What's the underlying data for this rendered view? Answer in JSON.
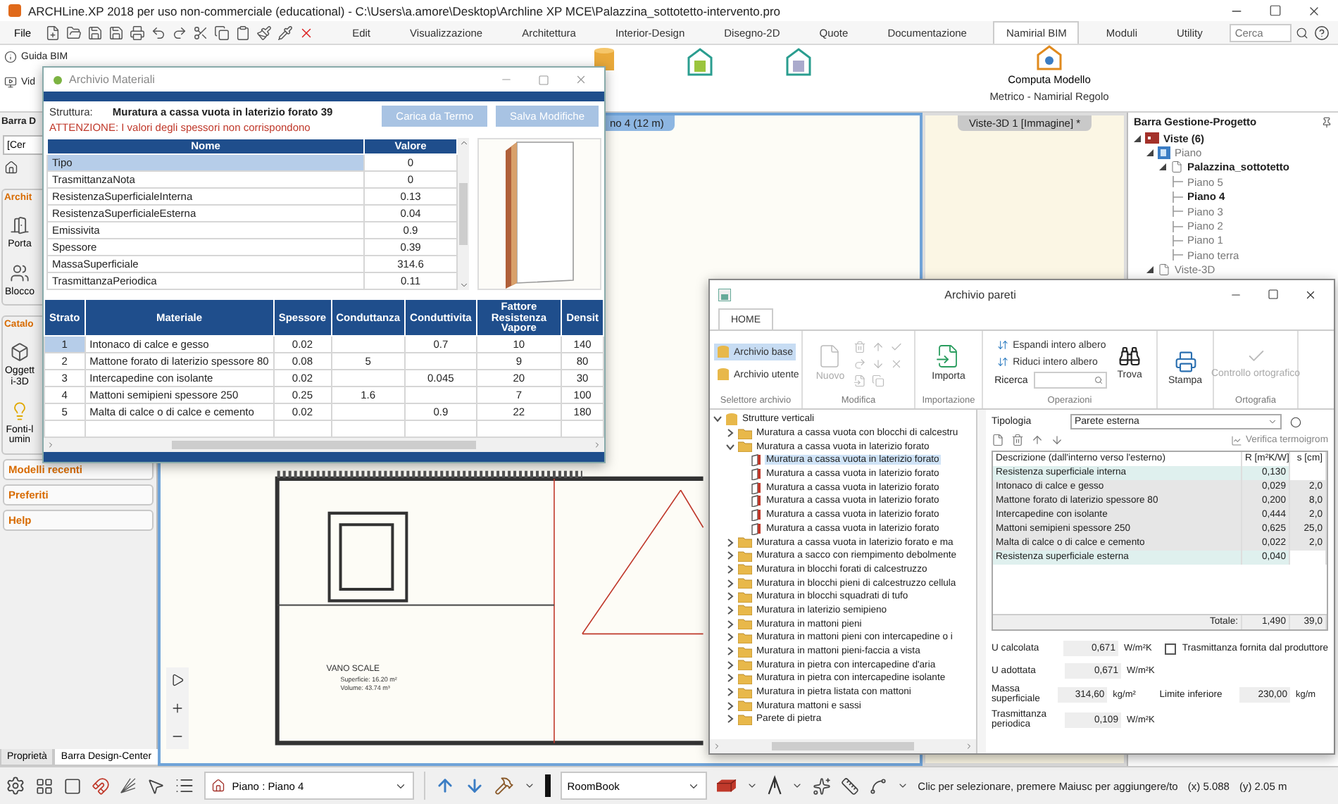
{
  "window": {
    "title": "ARCHLine.XP 2018 per uso non-commerciale (educational) - C:\\Users\\a.amore\\Desktop\\Archline XP MCE\\Palazzina_sottotetto-intervento.pro"
  },
  "menu": {
    "file": "File",
    "tabs": [
      {
        "label": "Edit",
        "selected": false
      },
      {
        "label": "Visualizzazione",
        "selected": false
      },
      {
        "label": "Architettura",
        "selected": false
      },
      {
        "label": "Interior-Design",
        "selected": false
      },
      {
        "label": "Disegno-2D",
        "selected": false
      },
      {
        "label": "Quote",
        "selected": false
      },
      {
        "label": "Documentazione",
        "selected": false
      },
      {
        "label": "Namirial BIM",
        "selected": true
      },
      {
        "label": "Moduli",
        "selected": false
      },
      {
        "label": "Utility",
        "selected": false
      }
    ]
  },
  "search": {
    "placeholder": "Cerca"
  },
  "ribbon": {
    "links": [
      "Guida BIM",
      "Vid"
    ],
    "command": "Computa Modello",
    "group_label": "Metrico - Namirial Regolo"
  },
  "left_panel": {
    "title": "Barra D",
    "search": {
      "value": "[Cer"
    },
    "sections": [
      {
        "title": "Archit",
        "items": [
          "Porta",
          "Blocco"
        ]
      },
      {
        "title": "Catalo",
        "items": [
          "Oggetti-3D",
          "Fonti-lumin"
        ]
      }
    ],
    "headers": [
      "Modelli recenti",
      "Preferiti",
      "Help"
    ],
    "tabs": [
      {
        "label": "Proprietà",
        "selected": false
      },
      {
        "label": "Barra Design-Center",
        "selected": true
      }
    ]
  },
  "views": [
    {
      "label": "no 4 (12 m)",
      "selected": true
    },
    {
      "label": "Viste-3D 1 [Immagine] *",
      "selected": false
    }
  ],
  "plan": {
    "room_name": "VANO SCALE",
    "area": "Superficie: 16.20 m²",
    "volume": "Volume: 43.74 m³"
  },
  "project_panel": {
    "title": "Barra Gestione-Progetto",
    "tree": [
      {
        "label": "Viste (6)",
        "active": true,
        "expanded": true,
        "children": [
          {
            "label": "Piano",
            "active": false,
            "expanded": true,
            "children": [
              {
                "label": "Palazzina_sottotetto",
                "active": true,
                "expanded": true,
                "children": [
                  {
                    "label": "Piano 5",
                    "active": false
                  },
                  {
                    "label": "Piano 4",
                    "active": true
                  },
                  {
                    "label": "Piano 3",
                    "active": false
                  },
                  {
                    "label": "Piano 2",
                    "active": false
                  },
                  {
                    "label": "Piano 1",
                    "active": false
                  },
                  {
                    "label": "Piano terra",
                    "active": false
                  }
                ]
              }
            ]
          },
          {
            "label": "Viste-3D",
            "active": false,
            "expanded": true
          }
        ]
      }
    ]
  },
  "materials_dialog": {
    "title": "Archivio Materiali",
    "structure_label": "Struttura:",
    "structure": "Muratura a cassa vuota in laterizio forato 39",
    "warning": "ATTENZIONE: I valori degli spessori non corrispondono",
    "buttons": [
      {
        "label": "Carica da Termo",
        "disabled": true
      },
      {
        "label": "Salva Modifiche",
        "disabled": true
      }
    ],
    "properties": {
      "columns": [
        "Nome",
        "Valore"
      ],
      "rows": [
        {
          "name": "Tipo",
          "value": "0",
          "selected": true
        },
        {
          "name": "TrasmittanzaNota",
          "value": "0",
          "selected": false
        },
        {
          "name": "ResistenzaSuperficialeInterna",
          "value": "0.13",
          "selected": false
        },
        {
          "name": "ResistenzaSuperficialeEsterna",
          "value": "0.04",
          "selected": false
        },
        {
          "name": "Emissivita",
          "value": "0.9",
          "selected": false
        },
        {
          "name": "Spessore",
          "value": "0.39",
          "selected": false
        },
        {
          "name": "MassaSuperficiale",
          "value": "314.6",
          "selected": false
        },
        {
          "name": "TrasmittanzaPeriodica",
          "value": "0.11",
          "selected": false
        }
      ]
    },
    "layers": {
      "columns": [
        "Strato",
        "Materiale",
        "Spessore",
        "Conduttanza",
        "Conduttivita",
        "Fattore Resistenza Vapore",
        "Densit"
      ],
      "rows": [
        {
          "strato": "1",
          "materiale": "Intonaco di calce e gesso",
          "spessore": "0.02",
          "conduttivita": "0.7",
          "fattore": "10",
          "column_7": "140",
          "selected": true
        },
        {
          "strato": "2",
          "materiale": "Mattone forato di laterizio spessore 80",
          "spessore": "0.08",
          "conduttanza": "5",
          "fattore": "9",
          "column_7": "80",
          "selected": false
        },
        {
          "strato": "3",
          "materiale": "Intercapedine con isolante",
          "spessore": "0.02",
          "conduttivita": "0.045",
          "fattore": "20",
          "column_7": "30",
          "selected": false
        },
        {
          "strato": "4",
          "materiale": "Mattoni semipieni spessore 250",
          "spessore": "0.25",
          "conduttanza": "1.6",
          "fattore": "7",
          "column_7": "100",
          "selected": false
        },
        {
          "strato": "5",
          "materiale": "Malta di calce o di calce e cemento",
          "spessore": "0.02",
          "conduttivita": "0.9",
          "fattore": "22",
          "column_7": "180",
          "selected": false
        }
      ]
    }
  },
  "pareti_dialog": {
    "title": "Archivio pareti",
    "tabs": [
      {
        "label": "HOME",
        "selected": true
      }
    ],
    "ribbon": {
      "archives": [
        {
          "label": "Archivio base",
          "selected": true
        },
        {
          "label": "Archivio utente",
          "selected": false
        }
      ],
      "new": {
        "label": "Nuovo",
        "disabled": true
      },
      "import": "Importa",
      "expand": "Espandi intero albero",
      "collapse": "Riduci intero albero",
      "search_label": "Ricerca",
      "find": "Trova",
      "print": "Stampa",
      "spell": {
        "label": "Controllo ortografico",
        "disabled": true
      },
      "groups": [
        "Selettore archivio",
        "Modifica",
        "Importazione",
        "Operazioni",
        "Ortografia"
      ]
    },
    "tree": [
      {
        "label": "Strutture verticali",
        "kind": "root",
        "expanded": true,
        "children": [
          {
            "label": "Muratura a cassa vuota con blocchi di calcestru",
            "kind": "folder",
            "expanded": false
          },
          {
            "label": "Muratura a cassa vuota in laterizio forato",
            "kind": "folder",
            "expanded": true,
            "children": [
              {
                "label": "Muratura a cassa vuota in laterizio forato",
                "kind": "wall",
                "selected": true
              },
              {
                "label": "Muratura a cassa vuota in laterizio forato",
                "kind": "wall",
                "selected": false
              },
              {
                "label": "Muratura a cassa vuota in laterizio forato",
                "kind": "wall",
                "selected": false
              },
              {
                "label": "Muratura a cassa vuota in laterizio forato",
                "kind": "wall",
                "selected": false
              },
              {
                "label": "Muratura a cassa vuota in laterizio forato",
                "kind": "wall",
                "selected": false
              },
              {
                "label": "Muratura a cassa vuota in laterizio forato",
                "kind": "wall",
                "selected": false
              }
            ]
          },
          {
            "label": "Muratura a cassa vuota in laterizio forato e ma",
            "kind": "folder",
            "expanded": false
          },
          {
            "label": "Muratura a sacco con riempimento debolmente",
            "kind": "folder",
            "expanded": false
          },
          {
            "label": "Muratura in blocchi forati di calcestruzzo",
            "kind": "folder",
            "expanded": false
          },
          {
            "label": "Muratura in blocchi pieni di calcestruzzo cellula",
            "kind": "folder",
            "expanded": false
          },
          {
            "label": "Muratura in blocchi squadrati di tufo",
            "kind": "folder",
            "expanded": false
          },
          {
            "label": "Muratura in laterizio semipieno",
            "kind": "folder",
            "expanded": false
          },
          {
            "label": "Muratura in mattoni pieni",
            "kind": "folder",
            "expanded": false
          },
          {
            "label": "Muratura in mattoni pieni con intercapedine o i",
            "kind": "folder",
            "expanded": false
          },
          {
            "label": "Muratura in mattoni pieni-faccia a vista",
            "kind": "folder",
            "expanded": false
          },
          {
            "label": "Muratura in pietra con intercapedine d'aria",
            "kind": "folder",
            "expanded": false
          },
          {
            "label": "Muratura in pietra con intercapedine isolante",
            "kind": "folder",
            "expanded": false
          },
          {
            "label": "Muratura in pietra listata con mattoni",
            "kind": "folder",
            "expanded": false
          },
          {
            "label": "Muratura mattoni e sassi",
            "kind": "folder",
            "expanded": false
          },
          {
            "label": "Parete di pietra",
            "kind": "folder",
            "expanded": false
          }
        ]
      }
    ],
    "type_label": "Tipologia",
    "type_value": "Parete esterna",
    "verify": "Verifica termoigrom",
    "table": {
      "columns": [
        "Descrizione (dall'interno verso l'esterno)",
        "R [m²K/W]",
        "s [cm]"
      ],
      "rows": [
        {
          "kind": "surface",
          "description": "Resistenza superficiale interna",
          "r": "0,130"
        },
        {
          "kind": "layer",
          "description": "Intonaco di calce e gesso",
          "r": "0,029",
          "s": "2,0"
        },
        {
          "kind": "layer",
          "description": "Mattone forato di laterizio spessore 80",
          "r": "0,200",
          "s": "8,0"
        },
        {
          "kind": "layer",
          "description": "Intercapedine con isolante",
          "r": "0,444",
          "s": "2,0"
        },
        {
          "kind": "layer",
          "description": "Mattoni semipieni spessore 250",
          "r": "0,625",
          "s": "25,0"
        },
        {
          "kind": "layer",
          "description": "Malta di calce o di calce e cemento",
          "r": "0,022",
          "s": "2,0"
        },
        {
          "kind": "surface",
          "description": "Resistenza superficiale esterna",
          "r": "0,040"
        }
      ],
      "total_label": "Totale:",
      "total_r": "1,490",
      "total_s": "39,0"
    },
    "fields": [
      {
        "label": "U calcolata",
        "value": "0,671",
        "unit": "W/m²K",
        "aside": {
          "kind": "checkbox",
          "label": "Trasmittanza fornita dal produttore",
          "checked": false
        }
      },
      {
        "label": "U adottata",
        "value": "0,671",
        "unit": "W/m²K"
      },
      {
        "label": "Massa superficiale",
        "value": "314,60",
        "unit": "kg/m²",
        "aside": {
          "kind": "field",
          "label": "Limite inferiore",
          "value": "230,00",
          "unit": "kg/m"
        }
      },
      {
        "label": "Trasmittanza periodica",
        "value": "0,109",
        "unit": "W/m²K"
      }
    ]
  },
  "status_bar": {
    "floor": "Piano : Piano 4",
    "roombook": "RoomBook",
    "message": "Clic per selezionare, premere Maiusc per aggiungere/to",
    "x": "(x) 5.088",
    "y": "(y) 2.05 m"
  }
}
